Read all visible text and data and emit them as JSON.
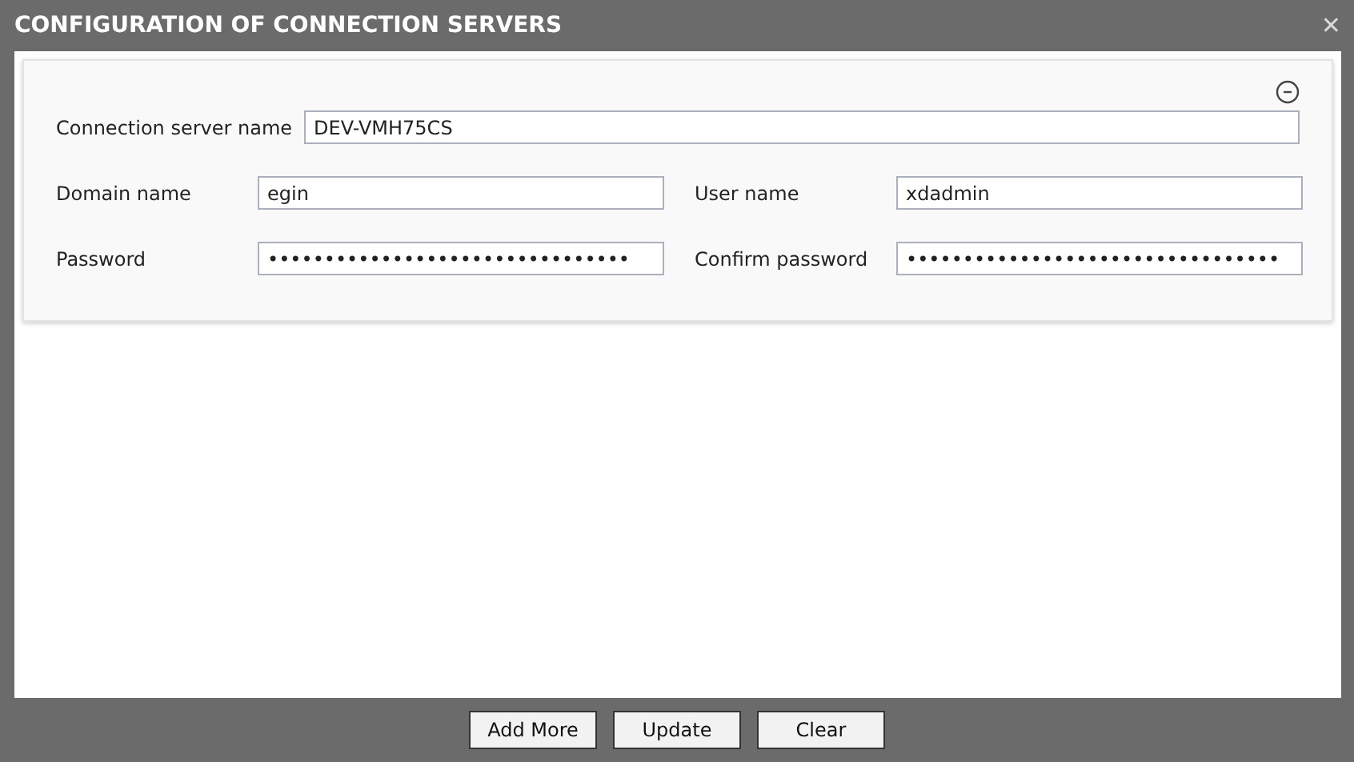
{
  "window": {
    "title": "CONFIGURATION OF CONNECTION SERVERS",
    "close": "✕"
  },
  "form": {
    "server_name": {
      "label": "Connection server name",
      "value": "DEV-VMH75CS"
    },
    "fields": [
      {
        "label": "Domain name",
        "value": "egin"
      },
      {
        "label": "User name",
        "value": "xdadmin"
      },
      {
        "label": "Password",
        "value": "••••••••••••••••••••••••••••••••"
      },
      {
        "label": "Confirm password",
        "value": "•••••••••••••••••••••••••••••••••"
      }
    ]
  },
  "buttons": [
    "Add More",
    "Update",
    "Clear"
  ]
}
